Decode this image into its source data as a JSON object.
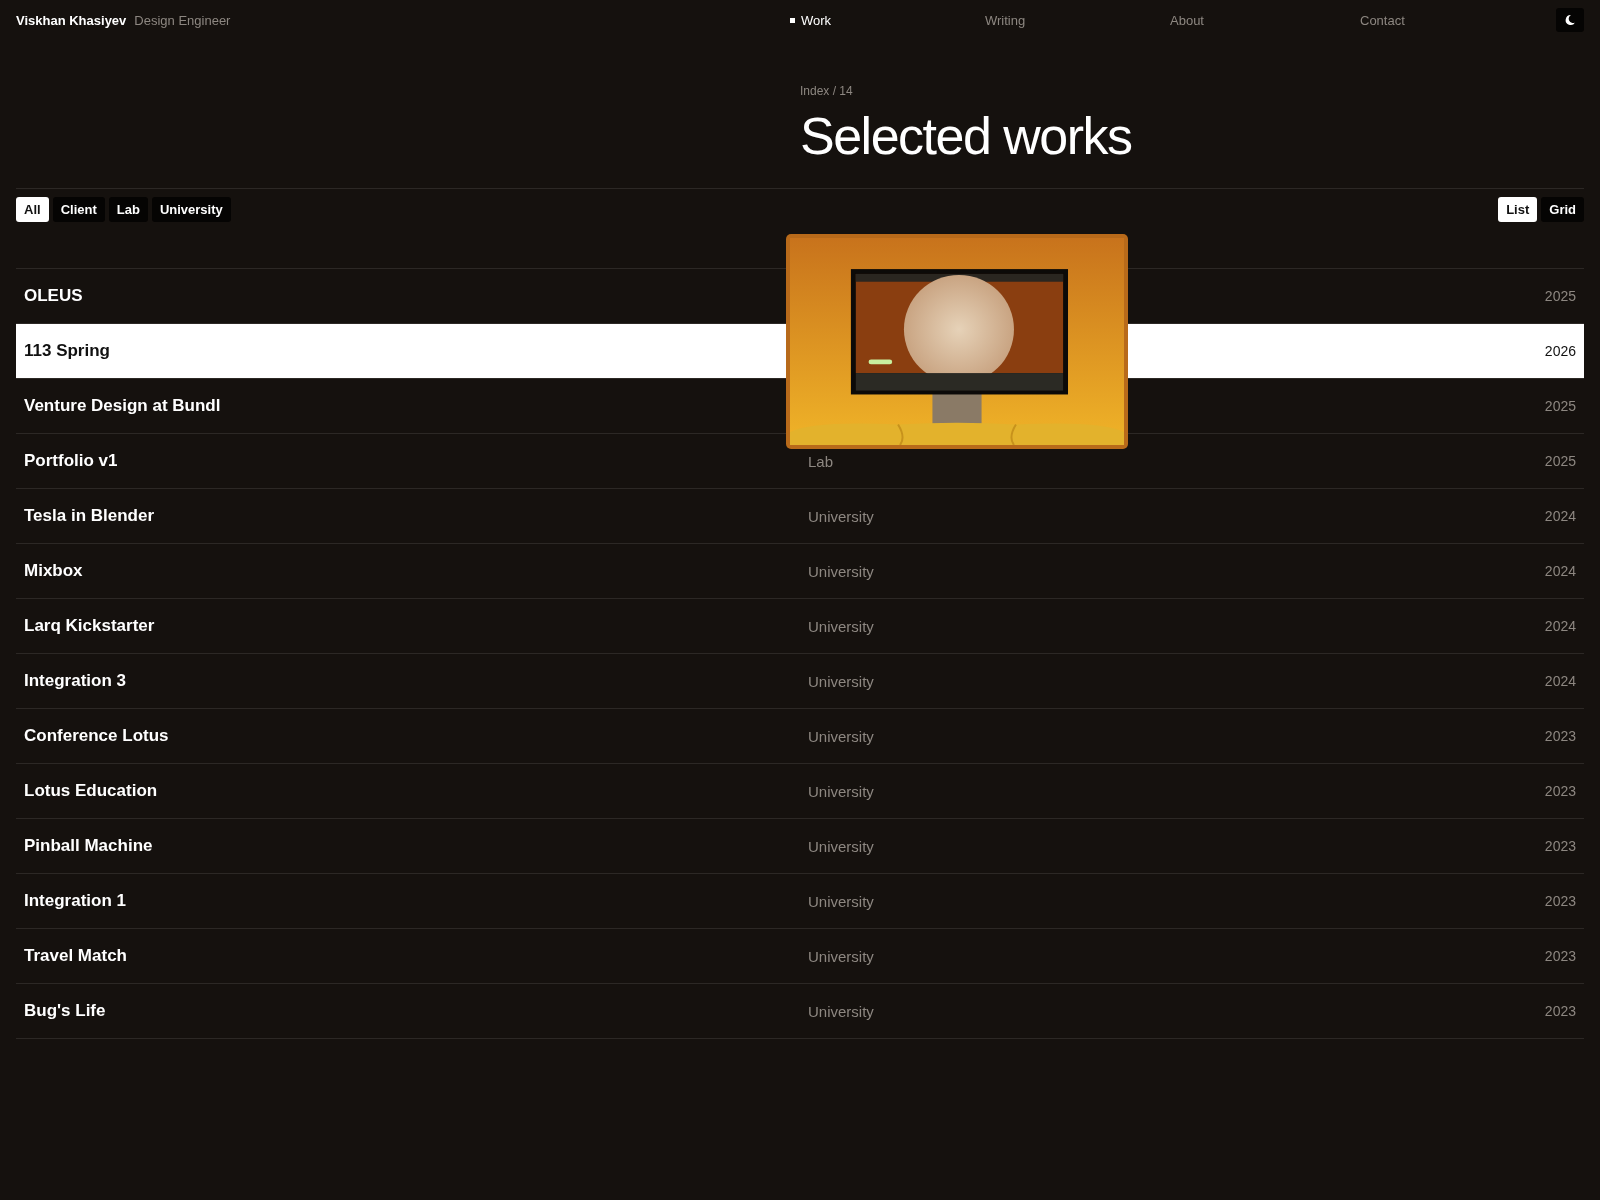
{
  "header": {
    "name": "Viskhan Khasiyev",
    "role": "Design Engineer",
    "nav": [
      {
        "label": "Work",
        "selected": true
      },
      {
        "label": "Writing",
        "selected": false
      },
      {
        "label": "About",
        "selected": false
      },
      {
        "label": "Contact",
        "selected": false
      }
    ]
  },
  "intro": {
    "eyebrow": "Index / 14",
    "title": "Selected works"
  },
  "filters": [
    {
      "label": "All",
      "selected": true
    },
    {
      "label": "Client",
      "selected": false
    },
    {
      "label": "Lab",
      "selected": false
    },
    {
      "label": "University",
      "selected": false
    }
  ],
  "views": [
    {
      "label": "List",
      "selected": true
    },
    {
      "label": "Grid",
      "selected": false
    }
  ],
  "projects": [
    {
      "name": "OLEUS",
      "year": "2025",
      "selected": false
    },
    {
      "name": "113 Spring",
      "year": "2026",
      "selected": true
    },
    {
      "name": "Venture Design at Bundl",
      "year": "2025",
      "selected": false
    },
    {
      "name": "Portfolio v1",
      "category": "Lab",
      "year": "2025",
      "selected": false
    },
    {
      "name": "Tesla in Blender",
      "category": "University",
      "year": "2024",
      "selected": false
    },
    {
      "name": "Mixbox",
      "category": "University",
      "year": "2024",
      "selected": false
    },
    {
      "name": "Larq Kickstarter",
      "category": "University",
      "year": "2024",
      "selected": false
    },
    {
      "name": "Integration 3",
      "category": "University",
      "year": "2024",
      "selected": false
    },
    {
      "name": "Conference Lotus",
      "category": "University",
      "year": "2023",
      "selected": false
    },
    {
      "name": "Lotus Education",
      "category": "University",
      "year": "2023",
      "selected": false
    },
    {
      "name": "Pinball Machine",
      "category": "University",
      "year": "2023",
      "selected": false
    },
    {
      "name": "Integration 1",
      "category": "University",
      "year": "2023",
      "selected": false
    },
    {
      "name": "Travel Match",
      "category": "University",
      "year": "2023",
      "selected": false
    },
    {
      "name": "Bug's Life",
      "category": "University",
      "year": "2023",
      "selected": false
    }
  ]
}
